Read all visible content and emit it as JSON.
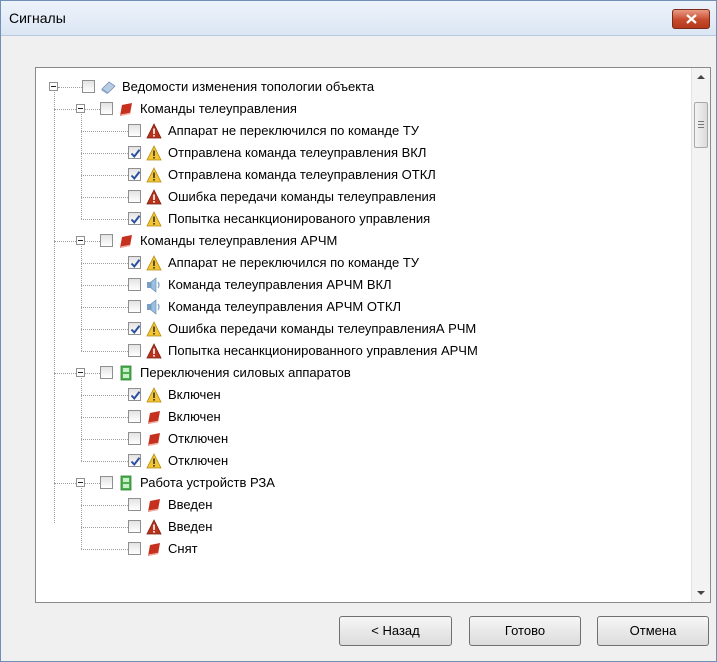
{
  "window": {
    "title": "Сигналы"
  },
  "tree": {
    "root": {
      "label": "Ведомости изменения топологии объекта",
      "checked": false,
      "icon": "eraser-icon"
    },
    "groups": [
      {
        "label": "Команды телеуправления",
        "icon": "red-book-icon",
        "checked": false,
        "items": [
          {
            "label": "Аппарат не переключился по команде ТУ",
            "checked": false,
            "icon": "red-warning-icon"
          },
          {
            "label": "Отправлена команда телеуправления ВКЛ",
            "checked": true,
            "icon": "yellow-warning-icon"
          },
          {
            "label": "Отправлена команда телеуправления ОТКЛ",
            "checked": true,
            "icon": "yellow-warning-icon"
          },
          {
            "label": "Ошибка передачи команды телеуправления",
            "checked": false,
            "icon": "red-warning-icon"
          },
          {
            "label": "Попытка несанкционированого управления",
            "checked": true,
            "icon": "yellow-warning-icon"
          }
        ]
      },
      {
        "label": "Команды телеуправления АРЧМ",
        "icon": "red-book-icon",
        "checked": false,
        "items": [
          {
            "label": "Аппарат не переключился по команде ТУ",
            "checked": true,
            "icon": "yellow-warning-icon"
          },
          {
            "label": "Команда телеуправления АРЧМ ВКЛ",
            "checked": false,
            "icon": "speaker-icon"
          },
          {
            "label": "Команда телеуправления АРЧМ ОТКЛ",
            "checked": false,
            "icon": "speaker-icon"
          },
          {
            "label": "Ошибка передачи команды телеуправленияА РЧМ",
            "checked": true,
            "icon": "yellow-warning-icon"
          },
          {
            "label": "Попытка несанкционированного управления АРЧМ",
            "checked": false,
            "icon": "red-warning-icon"
          }
        ]
      },
      {
        "label": "Переключения силовых аппаратов",
        "icon": "green-panel-icon",
        "checked": false,
        "items": [
          {
            "label": "Включен",
            "checked": true,
            "icon": "yellow-warning-icon"
          },
          {
            "label": "Включен",
            "checked": false,
            "icon": "red-book-icon"
          },
          {
            "label": "Отключен",
            "checked": false,
            "icon": "red-book-icon"
          },
          {
            "label": "Отключен",
            "checked": true,
            "icon": "yellow-warning-icon"
          }
        ]
      },
      {
        "label": "Работа устройств РЗА",
        "icon": "green-panel-icon",
        "checked": false,
        "items": [
          {
            "label": "Введен",
            "checked": false,
            "icon": "red-book-icon"
          },
          {
            "label": "Введен",
            "checked": false,
            "icon": "red-warning-icon"
          },
          {
            "label": "Снят",
            "checked": false,
            "icon": "red-book-icon"
          }
        ]
      }
    ]
  },
  "buttons": {
    "back": "< Назад",
    "done": "Готово",
    "cancel": "Отмена"
  },
  "colors": {
    "accent_check": "#2b4f9e",
    "warning_yellow": "#f2c531",
    "warning_red": "#b8331b",
    "book_red": "#c6311f",
    "panel_green": "#4caf50"
  }
}
